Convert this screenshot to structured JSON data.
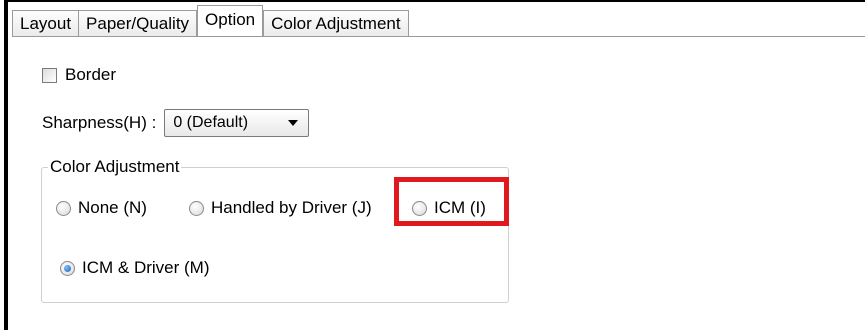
{
  "tabs": [
    {
      "label": "Layout",
      "active": false
    },
    {
      "label": "Paper/Quality",
      "active": false
    },
    {
      "label": "Option",
      "active": true
    },
    {
      "label": "Color Adjustment",
      "active": false
    }
  ],
  "border": {
    "label": "Border",
    "checked": false
  },
  "sharpness": {
    "label": "Sharpness(H) :",
    "value": "0 (Default)"
  },
  "color_adjustment": {
    "title": "Color Adjustment",
    "options": [
      {
        "label": "None (N)",
        "checked": false
      },
      {
        "label": "Handled by Driver (J)",
        "checked": false
      },
      {
        "label": "ICM (I)",
        "checked": false,
        "highlighted": true
      },
      {
        "label": "ICM  & Driver (M)",
        "checked": true
      }
    ]
  },
  "colors": {
    "highlight": "#e0191f",
    "radio_selected": "#1e5fae"
  }
}
